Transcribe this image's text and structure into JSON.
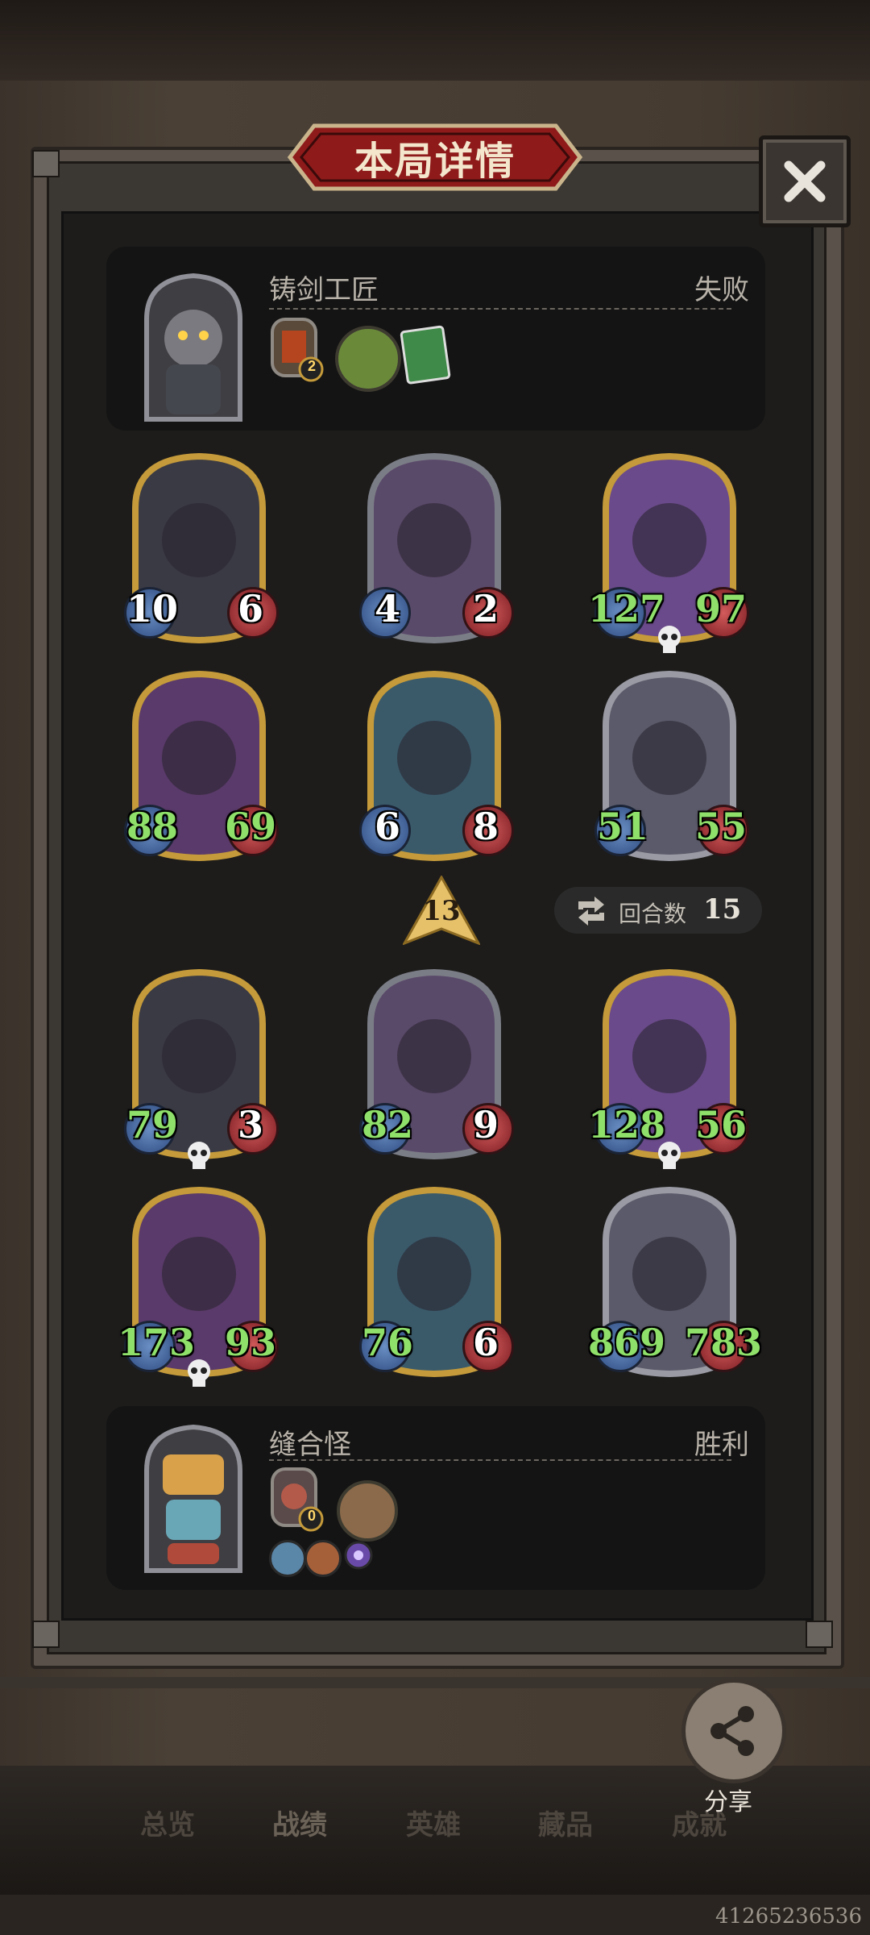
{
  "title": "本局详情",
  "player_top": {
    "name": "铸剑工匠",
    "result": "失败",
    "badge_count": "2"
  },
  "player_bottom": {
    "name": "缝合怪",
    "result": "胜利",
    "badge_count": "0"
  },
  "cards_top": [
    {
      "attack": "10",
      "health": "6",
      "atk_color": "white",
      "hp_color": "white",
      "skull": false
    },
    {
      "attack": "4",
      "health": "2",
      "atk_color": "white",
      "hp_color": "white",
      "skull": false
    },
    {
      "attack": "127",
      "health": "97",
      "atk_color": "green",
      "hp_color": "green",
      "skull": true
    },
    {
      "attack": "88",
      "health": "69",
      "atk_color": "green",
      "hp_color": "green",
      "skull": false
    },
    {
      "attack": "6",
      "health": "8",
      "atk_color": "white",
      "hp_color": "white",
      "skull": false
    },
    {
      "attack": "51",
      "health": "55",
      "atk_color": "green",
      "hp_color": "green",
      "skull": false
    }
  ],
  "cards_bottom": [
    {
      "attack": "79",
      "health": "3",
      "atk_color": "green",
      "hp_color": "white",
      "skull": true
    },
    {
      "attack": "82",
      "health": "9",
      "atk_color": "green",
      "hp_color": "white",
      "skull": false
    },
    {
      "attack": "128",
      "health": "56",
      "atk_color": "green",
      "hp_color": "green",
      "skull": true
    },
    {
      "attack": "173",
      "health": "93",
      "atk_color": "green",
      "hp_color": "green",
      "skull": true
    },
    {
      "attack": "76",
      "health": "6",
      "atk_color": "green",
      "hp_color": "white",
      "skull": false
    },
    {
      "attack": "869",
      "health": "783",
      "atk_color": "green",
      "hp_color": "green",
      "skull": false
    }
  ],
  "damage": "13",
  "round": {
    "label": "回合数",
    "value": "15"
  },
  "share_label": "分享",
  "nav": [
    "总览",
    "战绩",
    "英雄",
    "藏品",
    "成就"
  ],
  "watermark": "41265236536",
  "colors": {
    "accent_red": "#8e1a1a",
    "stat_green": "#8fe06a",
    "gold_frame": "#c49a3a",
    "silver_frame": "#7b7d86"
  }
}
